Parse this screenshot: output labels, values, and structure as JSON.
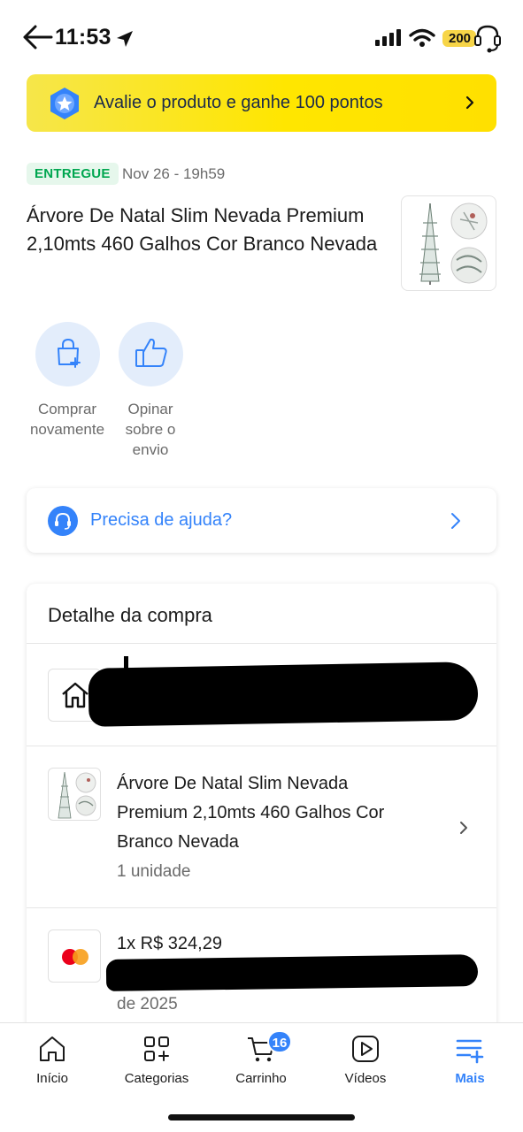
{
  "status_bar": {
    "time": "11:53",
    "battery": "200"
  },
  "promo": {
    "text": "Avalie o produto e ganhe 100 pontos"
  },
  "order": {
    "status": "ENTREGUE",
    "date": "Nov 26 - 19h59",
    "product_title": "Árvore De Natal Slim Nevada Premium 2,10mts 460 Galhos Cor Branco Nevada"
  },
  "actions": [
    {
      "label": "Comprar novamente",
      "icon": "bag-plus-icon"
    },
    {
      "label": "Opinar sobre o envio",
      "icon": "thumbs-up-icon"
    }
  ],
  "help": {
    "label": "Precisa de ajuda?"
  },
  "details": {
    "title": "Detalhe da compra",
    "item": {
      "title": "Árvore De Natal Slim Nevada Premium 2,10mts 460 Galhos Cor Branco Nevada",
      "quantity": "1 unidade"
    },
    "payment": {
      "amount": "1x R$ 324,29",
      "date_fragment": "de 2025"
    }
  },
  "bottom_nav": {
    "items": [
      {
        "label": "Início",
        "icon": "home-icon"
      },
      {
        "label": "Categorias",
        "icon": "categories-icon"
      },
      {
        "label": "Carrinho",
        "icon": "cart-icon",
        "badge": "16"
      },
      {
        "label": "Vídeos",
        "icon": "video-icon"
      },
      {
        "label": "Mais",
        "icon": "menu-plus-icon",
        "active": true
      }
    ]
  },
  "colors": {
    "accent": "#3483fa",
    "promo_yellow": "#ffe600",
    "success_green": "#00a650"
  }
}
